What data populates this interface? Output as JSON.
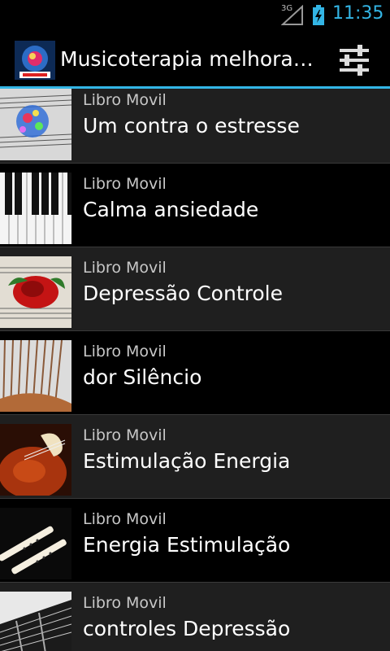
{
  "status_bar": {
    "network_type": "3G",
    "time": "11:35"
  },
  "action_bar": {
    "logo_icon": "app-logo-icon",
    "title": "Musicoterapia melhorar…",
    "settings_icon": "settings-sliders-icon"
  },
  "list": {
    "items": [
      {
        "subtitle": "Libro Movil",
        "title": "Um contra o estresse",
        "thumb_icon": "sheet-music-lights-thumb"
      },
      {
        "subtitle": "Libro Movil",
        "title": "Calma ansiedade",
        "thumb_icon": "piano-keys-thumb"
      },
      {
        "subtitle": "Libro Movil",
        "title": "Depressão Controle",
        "thumb_icon": "rose-sheet-music-thumb"
      },
      {
        "subtitle": "Libro Movil",
        "title": "dor Silêncio",
        "thumb_icon": "harp-strings-thumb"
      },
      {
        "subtitle": "Libro Movil",
        "title": "Estimulação Energia",
        "thumb_icon": "violin-thumb"
      },
      {
        "subtitle": "Libro Movil",
        "title": "Energia Estimulação",
        "thumb_icon": "recorder-flutes-thumb"
      },
      {
        "subtitle": "Libro Movil",
        "title": "controles Depressão",
        "thumb_icon": "guitar-thumb"
      }
    ]
  },
  "colors": {
    "accent": "#33b5e5",
    "row_dark": "#1f1f1f",
    "row_black": "#000000"
  }
}
